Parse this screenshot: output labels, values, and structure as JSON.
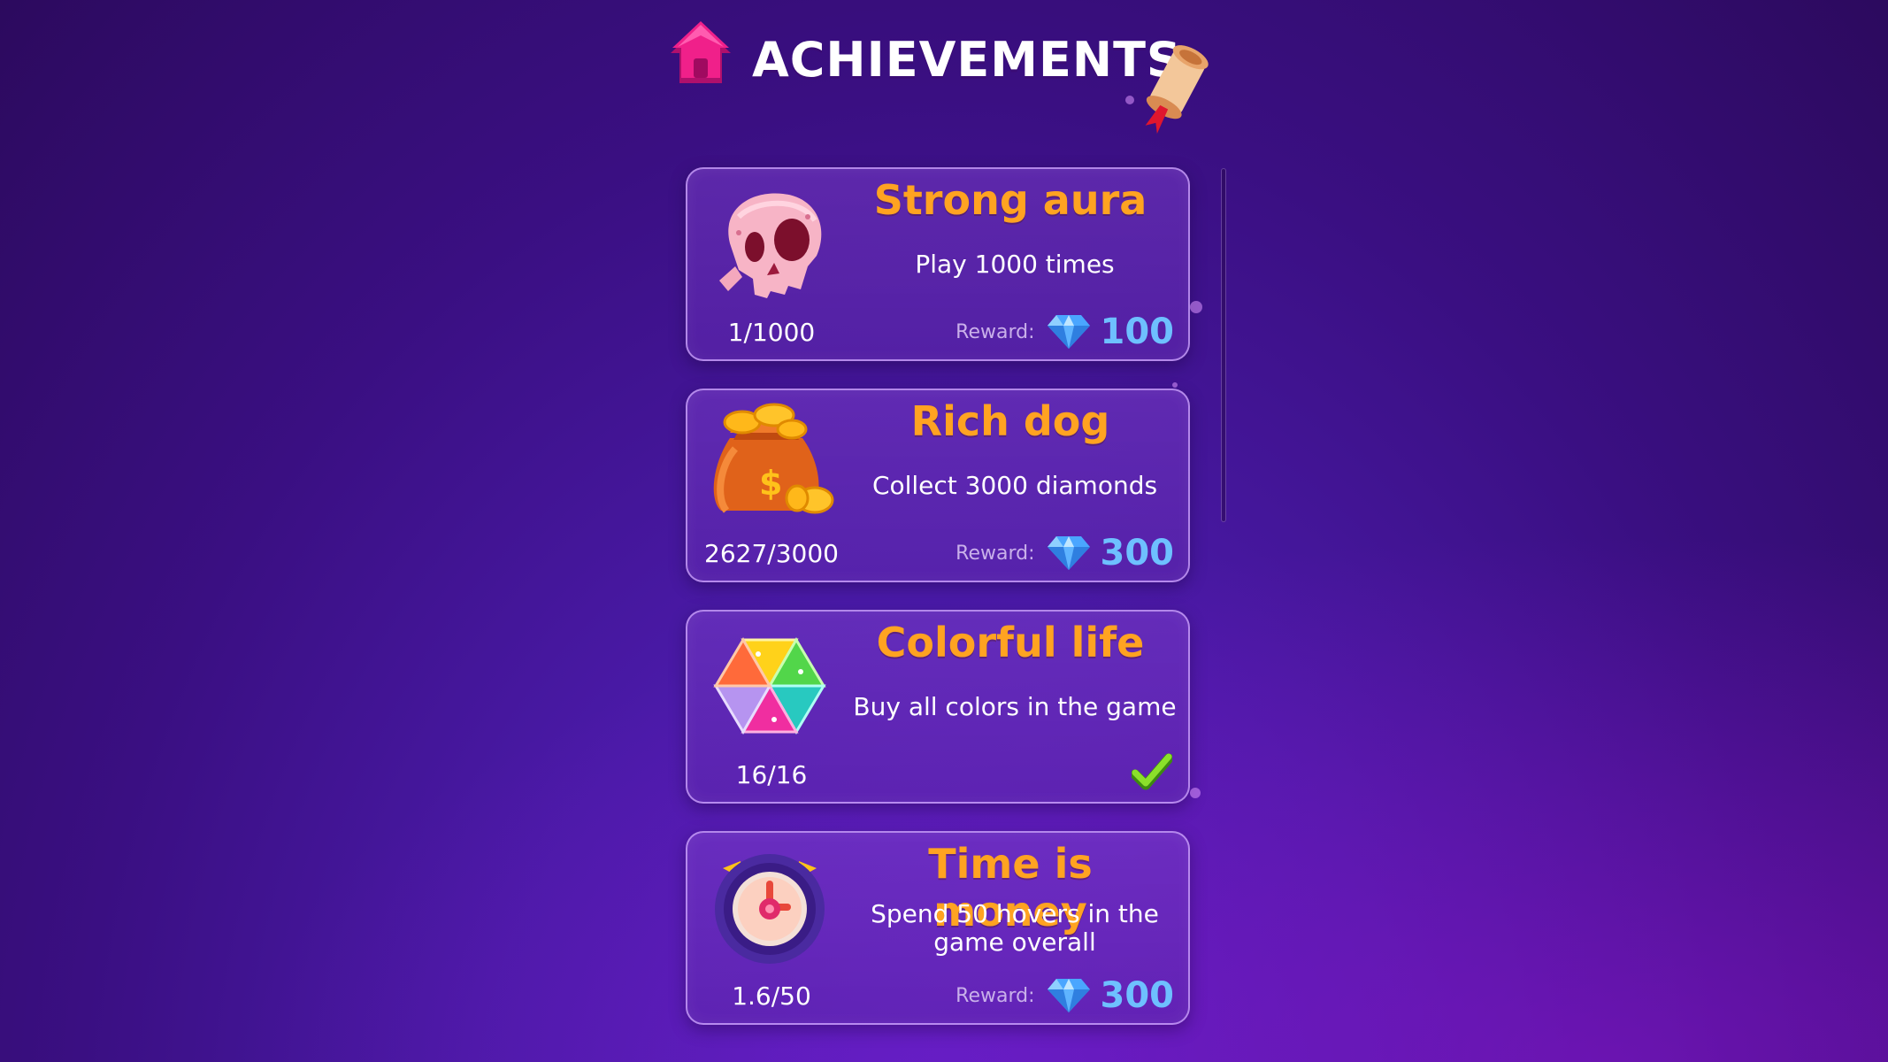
{
  "header": {
    "title": "ACHIEVEMENTS",
    "home_icon": "home-icon",
    "scroll_icon": "scroll-icon"
  },
  "colors": {
    "title_text": "#ffffff",
    "achievement_title": "#ffa321",
    "reward_value": "#6ec0ff",
    "background": "#3a0f82"
  },
  "achievements": [
    {
      "title": "Strong aura",
      "description": "Play 1000 times",
      "progress": "1/1000",
      "icon": "skull-icon",
      "reward_label": "Reward:",
      "reward_value": "100",
      "completed": false
    },
    {
      "title": "Rich dog",
      "description": "Collect 3000 diamonds",
      "progress": "2627/3000",
      "icon": "money-bag-icon",
      "reward_label": "Reward:",
      "reward_value": "300",
      "completed": false
    },
    {
      "title": "Colorful life",
      "description": "Buy all colors in the game",
      "progress": "16/16",
      "icon": "colorful-gems-icon",
      "completed": true
    },
    {
      "title": "Time is money",
      "description": "Spend 50 hovers in the game overall",
      "progress": "1.6/50",
      "icon": "alarm-clock-icon",
      "reward_label": "Reward:",
      "reward_value": "300",
      "completed": false
    }
  ]
}
